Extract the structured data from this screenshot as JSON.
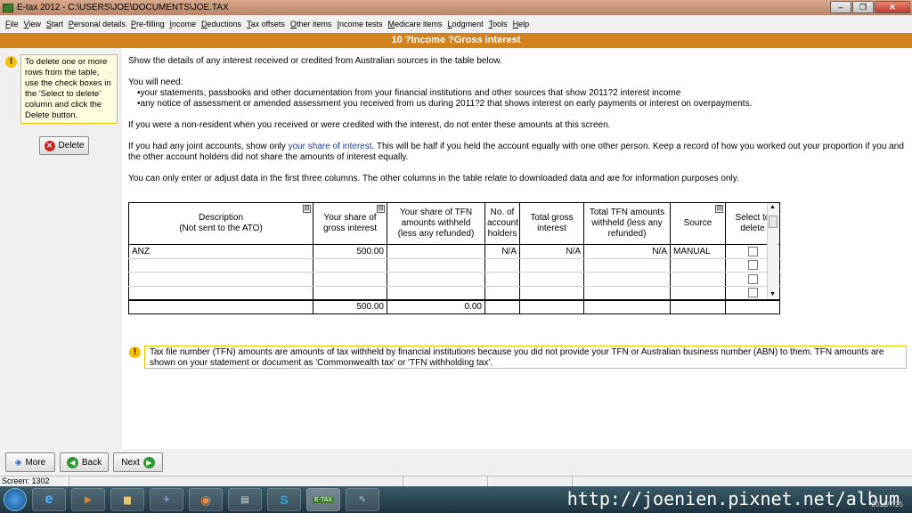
{
  "window": {
    "title": "E-tax 2012 - C:\\USERS\\JOE\\DOCUMENTS\\JOE.TAX"
  },
  "menu": [
    "File",
    "View",
    "Start",
    "Personal details",
    "Pre-filling",
    "Income",
    "Deductions",
    "Tax offsets",
    "Other items",
    "Income tests",
    "Medicare items",
    "Lodgment",
    "Tools",
    "Help"
  ],
  "page": {
    "title": "10 ?Income ?Gross interest"
  },
  "sidebar": {
    "hint": "To delete one or more rows from the table, use the check boxes in the 'Select to delete' column and click the Delete button.",
    "delete_label": "Delete"
  },
  "content": {
    "p1": "Show the details of any interest received or credited from Australian sources in the table below.",
    "p2": "You will need:",
    "b1": "•your statements, passbooks and other documentation from your financial institutions and other sources that show 2011?2 interest income",
    "b2": "•any notice of assessment or amended assessment you received from us during 2011?2 that shows interest on early payments or interest on overpayments.",
    "p3": "If you were a non-resident when you received or were credited with the interest, do not enter these amounts at this screen.",
    "p4a": "If you had any joint accounts, show only ",
    "p4link": "your share of interest",
    "p4b": ". This will be half if you held the account equally with one other person. Keep a record of how you worked out your proportion if you and the other account holders did not share the amounts of interest equally.",
    "p5": "You can only enter or adjust data in the first three columns. The other columns in the table relate to downloaded data and are for information purposes only."
  },
  "table": {
    "headers": [
      "Description\n(Not sent to the ATO)",
      "Your share of\ngross interest",
      "Your share of TFN\namounts withheld\n(less any refunded)",
      "No. of\naccount\nholders",
      "Total gross\ninterest",
      "Total TFN amounts\nwithheld (less any\nrefunded)",
      "Source",
      "Select to\ndelete"
    ],
    "rows": [
      [
        "ANZ",
        "500.00",
        "",
        "N/A",
        "N/A",
        "N/A",
        "MANUAL"
      ],
      [
        "",
        "",
        "",
        "",
        "",
        "",
        ""
      ],
      [
        "",
        "",
        "",
        "",
        "",
        "",
        ""
      ],
      [
        "",
        "",
        "",
        "",
        "",
        "",
        ""
      ]
    ],
    "totals": {
      "gross": "500.00",
      "tfn": "0.00"
    }
  },
  "note": "Tax file number (TFN) amounts are amounts of tax withheld by financial institutions because you did not provide your TFN or Australian business number (ABN) to them. TFN amounts are shown on your statement or document as 'Commonwealth tax' or 'TFN withholding tax'.",
  "nav": {
    "more": "More",
    "back": "Back",
    "next": "Next"
  },
  "status": {
    "screen": "Screen: 1302"
  },
  "taskbar": {
    "watermark": "http://joenien.pixnet.net/album",
    "date": "2012/7/25",
    "etax_label": "E-TAX"
  },
  "colors": {
    "header_orange": "#d4821e",
    "hint_border": "#e8c400",
    "link_blue": "#1a3da6"
  }
}
